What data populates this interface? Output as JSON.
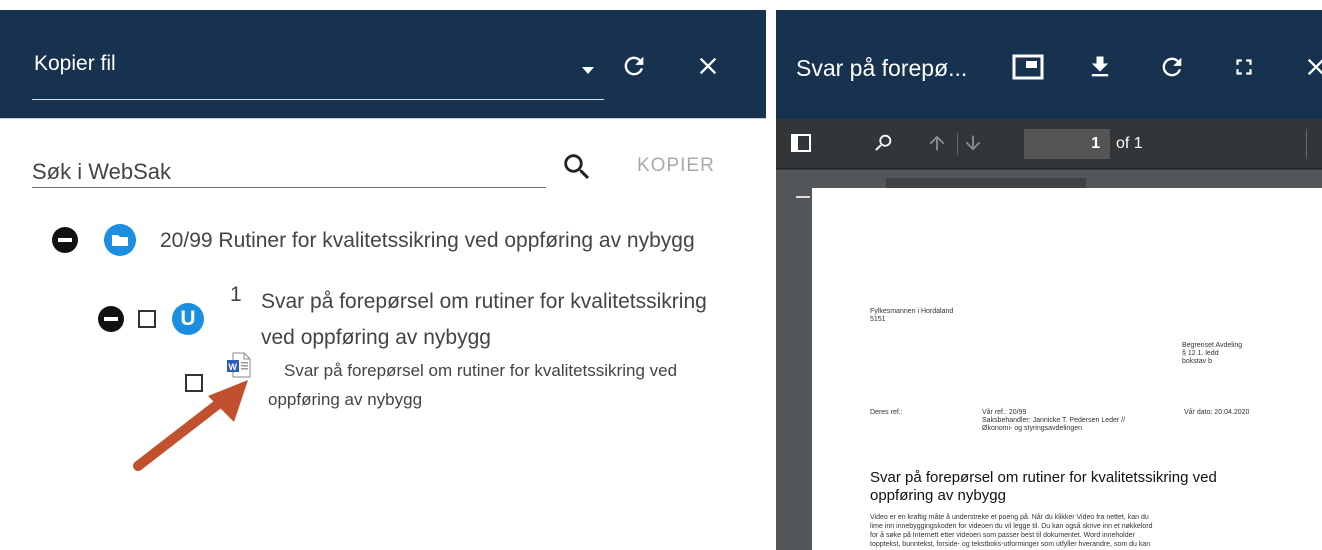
{
  "left_panel": {
    "title": "Kopier fil",
    "search": {
      "placeholder": "Søk i WebSak"
    },
    "copy_label": "KOPIER",
    "tree": {
      "case": {
        "number": "20/99",
        "title": "Rutiner for kvalitetssikring ved oppføring av nybygg"
      },
      "document": {
        "index": "1",
        "title_line1": "Svar på forepørsel om rutiner for kvalitetssikring",
        "title_line2": "ved oppføring av nybygg"
      },
      "file": {
        "title_line1": "Svar på forepørsel om rutiner for kvalitetssikring ved",
        "title_line2": "oppføring av nybygg"
      }
    }
  },
  "right_panel": {
    "title": "Svar på forepø...",
    "pdf_toolbar": {
      "page_current": "1",
      "page_total_label": "of 1"
    },
    "pdf_page": {
      "recipient_line1": "Fylkesmannen i Hordaland",
      "recipient_line2": "5151",
      "restriction_line1": "Begrenset Avdeling",
      "restriction_line2": "§ 12 1. ledd",
      "restriction_line3": "bokstav b",
      "your_ref_label": "Deres ref.:",
      "our_ref": "Vår ref.: 20/99",
      "case_handler_line1": "Saksbehandler: Jannicke T. Pedersen Leder //",
      "case_handler_line2": "Økonomi- og styringsavdelingen",
      "our_date": "Vår dato: 20.04.2020",
      "heading_line1": "Svar på forepørsel om rutiner for kvalitetssikring ved",
      "heading_line2": "oppføring av nybygg",
      "body_line1": "Video er en kraftig måte å understreke et poeng på. Når du klikker Video fra nettet, kan du",
      "body_line2": "lime inn innebyggingskoden for videoen du vil legge til. Du kan også skrive inn et nøkkelord",
      "body_line3": "for å søke på Internett etter videoen som passer best til dokumentet. Word inneholder",
      "body_line4": "topptekst, bunntekst, forside- og tekstboks-utforminger som utfyller hverandre, som du kan"
    }
  },
  "colors": {
    "header_bg": "#16324f",
    "accent_blue": "#1a8fe0",
    "arrow": "#c0502e"
  }
}
